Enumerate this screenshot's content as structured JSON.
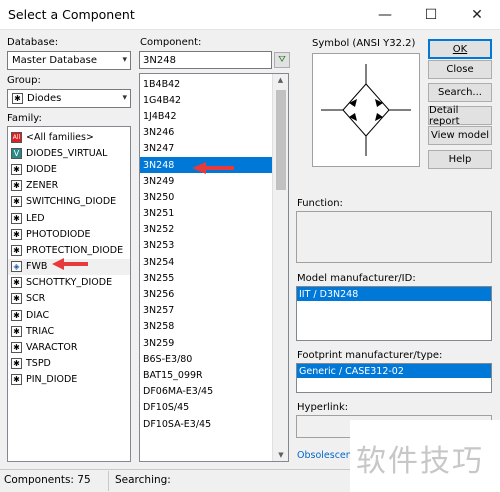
{
  "window": {
    "title": "Select a Component",
    "minimize_glyph": "—",
    "maximize_glyph": "☐",
    "close_glyph": "✕"
  },
  "database": {
    "label": "Database:",
    "value": "Master Database"
  },
  "group": {
    "label": "Group:",
    "value": "Diodes",
    "icon_glyph": "✱"
  },
  "family": {
    "label": "Family:",
    "items": [
      {
        "label": "<All families>",
        "icon": "all-icon",
        "glyph": "All"
      },
      {
        "label": "DIODES_VIRTUAL",
        "icon": "virtual-diode-icon",
        "glyph": "V"
      },
      {
        "label": "DIODE",
        "icon": "diode-icon",
        "glyph": "✱"
      },
      {
        "label": "ZENER",
        "icon": "zener-icon",
        "glyph": "✱"
      },
      {
        "label": "SWITCHING_DIODE",
        "icon": "switching-diode-icon",
        "glyph": "✱"
      },
      {
        "label": "LED",
        "icon": "led-icon",
        "glyph": "✱"
      },
      {
        "label": "PHOTODIODE",
        "icon": "photodiode-icon",
        "glyph": "✱"
      },
      {
        "label": "PROTECTION_DIODE",
        "icon": "protection-diode-icon",
        "glyph": "✱"
      },
      {
        "label": "FWB",
        "icon": "bridge-rectifier-icon",
        "glyph": "◈"
      },
      {
        "label": "SCHOTTKY_DIODE",
        "icon": "schottky-icon",
        "glyph": "✱"
      },
      {
        "label": "SCR",
        "icon": "scr-icon",
        "glyph": "✱"
      },
      {
        "label": "DIAC",
        "icon": "diac-icon",
        "glyph": "✱"
      },
      {
        "label": "TRIAC",
        "icon": "triac-icon",
        "glyph": "✱"
      },
      {
        "label": "VARACTOR",
        "icon": "varactor-icon",
        "glyph": "✱"
      },
      {
        "label": "TSPD",
        "icon": "tspd-icon",
        "glyph": "✱"
      },
      {
        "label": "PIN_DIODE",
        "icon": "pin-diode-icon",
        "glyph": "✱"
      }
    ]
  },
  "component": {
    "label": "Component:",
    "search_value": "3N248",
    "filter_glyph": "⛛",
    "selected": "3N248",
    "items": [
      "1B4B42",
      "1G4B42",
      "1J4B42",
      "3N246",
      "3N247",
      "3N248",
      "3N249",
      "3N250",
      "3N251",
      "3N252",
      "3N253",
      "3N254",
      "3N255",
      "3N256",
      "3N257",
      "3N258",
      "3N259",
      "B6S-E3/80",
      "BAT15_099R",
      "DF06MA-E3/45",
      "DF10S/45",
      "DF10SA-E3/45"
    ]
  },
  "symbol": {
    "label": "Symbol (ANSI Y32.2)"
  },
  "buttons": {
    "ok": "OK",
    "close": "Close",
    "search": "Search...",
    "detail": "Detail report",
    "view_model": "View model",
    "help": "Help"
  },
  "function": {
    "label": "Function:"
  },
  "model": {
    "label": "Model manufacturer/ID:",
    "value": "IIT / D3N248"
  },
  "footprint": {
    "label": "Footprint manufacturer/type:",
    "value": "Generic / CASE312-02"
  },
  "hyperlink": {
    "label": "Hyperlink:"
  },
  "obsolescence": {
    "label": "Obsolescenc"
  },
  "status": {
    "components_label": "Components: 75",
    "searching_label": "Searching:"
  },
  "watermark": {
    "text": "软件技巧"
  },
  "colors": {
    "selection": "#0078d7",
    "arrow": "#e83a3a"
  }
}
